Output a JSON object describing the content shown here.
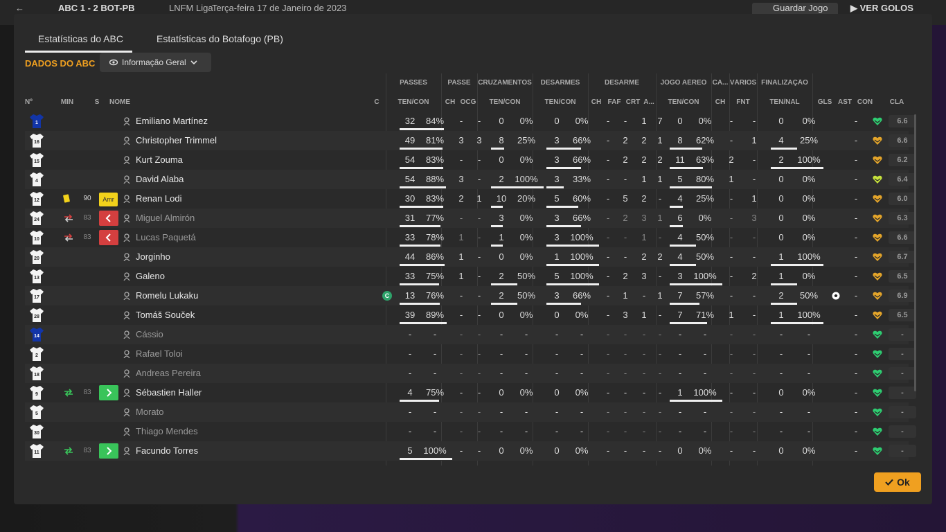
{
  "topbar": {
    "match": "ABC  1 - 2  BOT-PB",
    "league": "LNFM Liga",
    "date": "Terça-feira 17 de Janeiro de 2023",
    "save_label": "Guardar Jogo",
    "goals_label": "VER GOLOS"
  },
  "tabs": [
    {
      "label": "Estatísticas do ABC"
    },
    {
      "label": "Estatísticas do Botafogo (PB)"
    }
  ],
  "section_title": "DADOS DO ABC",
  "view_select": {
    "value": "Informação Geral"
  },
  "group_headers": [
    "PASSES",
    "PASSE",
    "CRUZAMENTOS",
    "DESARMES",
    "DESARME",
    "JOGO AÉREO",
    "CA...",
    "VÁRIOS",
    "FINALIZAÇÃO"
  ],
  "col_headers": [
    "Nº",
    "MIN",
    "S",
    "NOME",
    "C",
    "TEN/CON",
    "CH",
    "OCG",
    "TEN/CON",
    "TEN/CON",
    "CH",
    "FAF",
    "CRT",
    "A...",
    "TEN/CON",
    "CH",
    "FNT",
    "TEN/NAL",
    "GLS",
    "AST",
    "CON",
    "CLA"
  ],
  "colors": {
    "accent": "#f0a020",
    "green": "#39c45a",
    "red": "#d43f3f",
    "yellow": "#f2d21b",
    "heart_green": "#2ecc71",
    "heart_gold": "#e4a52a",
    "heart_lime": "#c7e23c"
  },
  "players": [
    {
      "no": "1",
      "min": "",
      "sub": "",
      "name": "Emiliano Martínez",
      "cap": false,
      "active": true,
      "pa": "32",
      "pp": "84%",
      "pf": 0.84,
      "pch": "-",
      "ocg": "-",
      "ca": "0",
      "cp": "0%",
      "cf": 0,
      "da": "0",
      "dp": "0%",
      "df": 0,
      "dch": "-",
      "faf": "-",
      "crt": "1",
      "a": "7",
      "aa": "0",
      "ap": "0%",
      "af": 0,
      "cach": "-",
      "fnt": "-",
      "fa": "0",
      "fp": "0%",
      "ff": 0,
      "gls": false,
      "ast": "-",
      "heart": "green",
      "cla": "6.6",
      "gk": true
    },
    {
      "no": "16",
      "min": "",
      "sub": "",
      "name": "Christopher Trimmel",
      "cap": false,
      "active": true,
      "pa": "49",
      "pp": "81%",
      "pf": 0.81,
      "pch": "3",
      "ocg": "3",
      "ca": "8",
      "cp": "25%",
      "cf": 0.25,
      "da": "3",
      "dp": "66%",
      "df": 0.66,
      "dch": "-",
      "faf": "2",
      "crt": "2",
      "a": "1",
      "aa": "8",
      "ap": "62%",
      "af": 0.62,
      "cach": "-",
      "fnt": "1",
      "fa": "4",
      "fp": "25%",
      "ff": 0.25,
      "gls": false,
      "ast": "-",
      "heart": "gold",
      "cla": "6.6"
    },
    {
      "no": "15",
      "min": "",
      "sub": "",
      "name": "Kurt Zouma",
      "cap": false,
      "active": true,
      "pa": "54",
      "pp": "83%",
      "pf": 0.83,
      "pch": "-",
      "ocg": "-",
      "ca": "0",
      "cp": "0%",
      "cf": 0,
      "da": "3",
      "dp": "66%",
      "df": 0.66,
      "dch": "-",
      "faf": "2",
      "crt": "2",
      "a": "2",
      "aa": "11",
      "ap": "63%",
      "af": 0.63,
      "cach": "2",
      "fnt": "-",
      "fa": "2",
      "fp": "100%",
      "ff": 1,
      "gls": false,
      "ast": "-",
      "heart": "gold",
      "cla": "6.2"
    },
    {
      "no": "4",
      "min": "",
      "sub": "",
      "name": "David Alaba",
      "cap": false,
      "active": true,
      "pa": "54",
      "pp": "88%",
      "pf": 0.88,
      "pch": "3",
      "ocg": "-",
      "ca": "2",
      "cp": "100%",
      "cf": 1,
      "da": "3",
      "dp": "33%",
      "df": 0.33,
      "dch": "-",
      "faf": "-",
      "crt": "1",
      "a": "1",
      "aa": "5",
      "ap": "80%",
      "af": 0.8,
      "cach": "1",
      "fnt": "-",
      "fa": "0",
      "fp": "0%",
      "ff": 0,
      "gls": false,
      "ast": "-",
      "heart": "lime",
      "cla": "6.4"
    },
    {
      "no": "12",
      "min": "90",
      "sub": "amr",
      "name": "Renan Lodi",
      "cap": false,
      "active": true,
      "pa": "30",
      "pp": "83%",
      "pf": 0.83,
      "pch": "2",
      "ocg": "1",
      "ca": "10",
      "cp": "20%",
      "cf": 0.2,
      "da": "5",
      "dp": "60%",
      "df": 0.6,
      "dch": "-",
      "faf": "5",
      "crt": "2",
      "a": "-",
      "aa": "4",
      "ap": "25%",
      "af": 0.25,
      "cach": "-",
      "fnt": "1",
      "fa": "0",
      "fp": "0%",
      "ff": 0,
      "gls": false,
      "ast": "-",
      "heart": "gold",
      "cla": "6.0"
    },
    {
      "no": "24",
      "min": "83",
      "sub": "out",
      "name": "Miguel Almirón",
      "cap": false,
      "active": false,
      "pa": "31",
      "pp": "77%",
      "pf": 0.77,
      "pch": "-",
      "ocg": "-",
      "ca": "3",
      "cp": "0%",
      "cf": 0,
      "da": "3",
      "dp": "66%",
      "df": 0.66,
      "dch": "-",
      "faf": "2",
      "crt": "3",
      "a": "1",
      "aa": "6",
      "ap": "0%",
      "af": 0,
      "cach": "-",
      "fnt": "3",
      "fa": "0",
      "fp": "0%",
      "ff": 0,
      "gls": false,
      "ast": "-",
      "heart": "gold",
      "cla": "6.3"
    },
    {
      "no": "10",
      "min": "83",
      "sub": "out",
      "name": "Lucas Paquetá",
      "cap": false,
      "active": false,
      "pa": "33",
      "pp": "78%",
      "pf": 0.78,
      "pch": "1",
      "ocg": "-",
      "ca": "1",
      "cp": "0%",
      "cf": 0,
      "da": "3",
      "dp": "100%",
      "df": 1,
      "dch": "-",
      "faf": "-",
      "crt": "1",
      "a": "-",
      "aa": "4",
      "ap": "50%",
      "af": 0.5,
      "cach": "-",
      "fnt": "-",
      "fa": "0",
      "fp": "0%",
      "ff": 0,
      "gls": false,
      "ast": "-",
      "heart": "gold",
      "cla": "6.6"
    },
    {
      "no": "20",
      "min": "",
      "sub": "",
      "name": "Jorginho",
      "cap": false,
      "active": true,
      "pa": "44",
      "pp": "86%",
      "pf": 0.86,
      "pch": "1",
      "ocg": "-",
      "ca": "0",
      "cp": "0%",
      "cf": 0,
      "da": "1",
      "dp": "100%",
      "df": 1,
      "dch": "-",
      "faf": "-",
      "crt": "2",
      "a": "2",
      "aa": "4",
      "ap": "50%",
      "af": 0.5,
      "cach": "-",
      "fnt": "-",
      "fa": "1",
      "fp": "100%",
      "ff": 1,
      "gls": false,
      "ast": "-",
      "heart": "gold",
      "cla": "6.7"
    },
    {
      "no": "13",
      "min": "",
      "sub": "",
      "name": "Galeno",
      "cap": false,
      "active": true,
      "pa": "33",
      "pp": "75%",
      "pf": 0.75,
      "pch": "1",
      "ocg": "-",
      "ca": "2",
      "cp": "50%",
      "cf": 0.5,
      "da": "5",
      "dp": "100%",
      "df": 1,
      "dch": "-",
      "faf": "2",
      "crt": "3",
      "a": "-",
      "aa": "3",
      "ap": "100%",
      "af": 1,
      "cach": "-",
      "fnt": "2",
      "fa": "1",
      "fp": "0%",
      "ff": 0,
      "gls": false,
      "ast": "-",
      "heart": "gold",
      "cla": "6.5"
    },
    {
      "no": "17",
      "min": "",
      "sub": "",
      "name": "Romelu Lukaku",
      "cap": true,
      "active": true,
      "pa": "13",
      "pp": "76%",
      "pf": 0.76,
      "pch": "-",
      "ocg": "-",
      "ca": "2",
      "cp": "50%",
      "cf": 0.5,
      "da": "3",
      "dp": "66%",
      "df": 0.66,
      "dch": "-",
      "faf": "1",
      "crt": "-",
      "a": "1",
      "aa": "7",
      "ap": "57%",
      "af": 0.57,
      "cach": "-",
      "fnt": "-",
      "fa": "2",
      "fp": "50%",
      "ff": 0.5,
      "gls": true,
      "ast": "-",
      "heart": "gold",
      "cla": "6.9"
    },
    {
      "no": "28",
      "min": "",
      "sub": "",
      "name": "Tomáš Souček",
      "cap": false,
      "active": true,
      "pa": "39",
      "pp": "89%",
      "pf": 0.89,
      "pch": "-",
      "ocg": "-",
      "ca": "0",
      "cp": "0%",
      "cf": 0,
      "da": "0",
      "dp": "0%",
      "df": 0,
      "dch": "-",
      "faf": "3",
      "crt": "1",
      "a": "-",
      "aa": "7",
      "ap": "71%",
      "af": 0.71,
      "cach": "1",
      "fnt": "-",
      "fa": "1",
      "fp": "100%",
      "ff": 1,
      "gls": false,
      "ast": "-",
      "heart": "gold",
      "cla": "6.5"
    },
    {
      "no": "14",
      "min": "",
      "sub": "",
      "name": "Cássio",
      "cap": false,
      "active": false,
      "pa": "-",
      "pp": "-",
      "pf": 0,
      "pch": "-",
      "ocg": "-",
      "ca": "-",
      "cp": "-",
      "cf": 0,
      "da": "-",
      "dp": "-",
      "df": 0,
      "dch": "-",
      "faf": "-",
      "crt": "-",
      "a": "-",
      "aa": "-",
      "ap": "-",
      "af": 0,
      "cach": "-",
      "fnt": "-",
      "fa": "-",
      "fp": "-",
      "ff": 0,
      "gls": false,
      "ast": "-",
      "heart": "green",
      "cla": "-",
      "gk": true
    },
    {
      "no": "2",
      "min": "",
      "sub": "",
      "name": "Rafael Toloi",
      "cap": false,
      "active": false,
      "pa": "-",
      "pp": "-",
      "pf": 0,
      "pch": "-",
      "ocg": "-",
      "ca": "-",
      "cp": "-",
      "cf": 0,
      "da": "-",
      "dp": "-",
      "df": 0,
      "dch": "-",
      "faf": "-",
      "crt": "-",
      "a": "-",
      "aa": "-",
      "ap": "-",
      "af": 0,
      "cach": "-",
      "fnt": "-",
      "fa": "-",
      "fp": "-",
      "ff": 0,
      "gls": false,
      "ast": "-",
      "heart": "green",
      "cla": "-"
    },
    {
      "no": "18",
      "min": "",
      "sub": "",
      "name": "Andreas Pereira",
      "cap": false,
      "active": false,
      "pa": "-",
      "pp": "-",
      "pf": 0,
      "pch": "-",
      "ocg": "-",
      "ca": "-",
      "cp": "-",
      "cf": 0,
      "da": "-",
      "dp": "-",
      "df": 0,
      "dch": "-",
      "faf": "-",
      "crt": "-",
      "a": "-",
      "aa": "-",
      "ap": "-",
      "af": 0,
      "cach": "-",
      "fnt": "-",
      "fa": "-",
      "fp": "-",
      "ff": 0,
      "gls": false,
      "ast": "-",
      "heart": "green",
      "cla": "-"
    },
    {
      "no": "9",
      "min": "83",
      "sub": "in",
      "name": "Sébastien Haller",
      "cap": false,
      "active": true,
      "pa": "4",
      "pp": "75%",
      "pf": 0.75,
      "pch": "-",
      "ocg": "-",
      "ca": "0",
      "cp": "0%",
      "cf": 0,
      "da": "0",
      "dp": "0%",
      "df": 0,
      "dch": "-",
      "faf": "-",
      "crt": "-",
      "a": "-",
      "aa": "1",
      "ap": "100%",
      "af": 1,
      "cach": "-",
      "fnt": "-",
      "fa": "0",
      "fp": "0%",
      "ff": 0,
      "gls": false,
      "ast": "-",
      "heart": "green",
      "cla": "-"
    },
    {
      "no": "5",
      "min": "",
      "sub": "",
      "name": "Morato",
      "cap": false,
      "active": false,
      "pa": "-",
      "pp": "-",
      "pf": 0,
      "pch": "-",
      "ocg": "-",
      "ca": "-",
      "cp": "-",
      "cf": 0,
      "da": "-",
      "dp": "-",
      "df": 0,
      "dch": "-",
      "faf": "-",
      "crt": "-",
      "a": "-",
      "aa": "-",
      "ap": "-",
      "af": 0,
      "cach": "-",
      "fnt": "-",
      "fa": "-",
      "fp": "-",
      "ff": 0,
      "gls": false,
      "ast": "-",
      "heart": "green",
      "cla": "-"
    },
    {
      "no": "30",
      "min": "",
      "sub": "",
      "name": "Thiago Mendes",
      "cap": false,
      "active": false,
      "pa": "-",
      "pp": "-",
      "pf": 0,
      "pch": "-",
      "ocg": "-",
      "ca": "-",
      "cp": "-",
      "cf": 0,
      "da": "-",
      "dp": "-",
      "df": 0,
      "dch": "-",
      "faf": "-",
      "crt": "-",
      "a": "-",
      "aa": "-",
      "ap": "-",
      "af": 0,
      "cach": "-",
      "fnt": "-",
      "fa": "-",
      "fp": "-",
      "ff": 0,
      "gls": false,
      "ast": "-",
      "heart": "green",
      "cla": "-"
    },
    {
      "no": "11",
      "min": "83",
      "sub": "in",
      "name": "Facundo Torres",
      "cap": false,
      "active": true,
      "pa": "5",
      "pp": "100%",
      "pf": 1,
      "pch": "-",
      "ocg": "-",
      "ca": "0",
      "cp": "0%",
      "cf": 0,
      "da": "0",
      "dp": "0%",
      "df": 0,
      "dch": "-",
      "faf": "-",
      "crt": "-",
      "a": "-",
      "aa": "0",
      "ap": "0%",
      "af": 0,
      "cach": "-",
      "fnt": "-",
      "fa": "0",
      "fp": "0%",
      "ff": 0,
      "gls": false,
      "ast": "-",
      "heart": "green",
      "cla": "-"
    }
  ],
  "labels": {
    "amr": "Amr",
    "captain": "C"
  },
  "ok_button": {
    "label": "Ok"
  }
}
